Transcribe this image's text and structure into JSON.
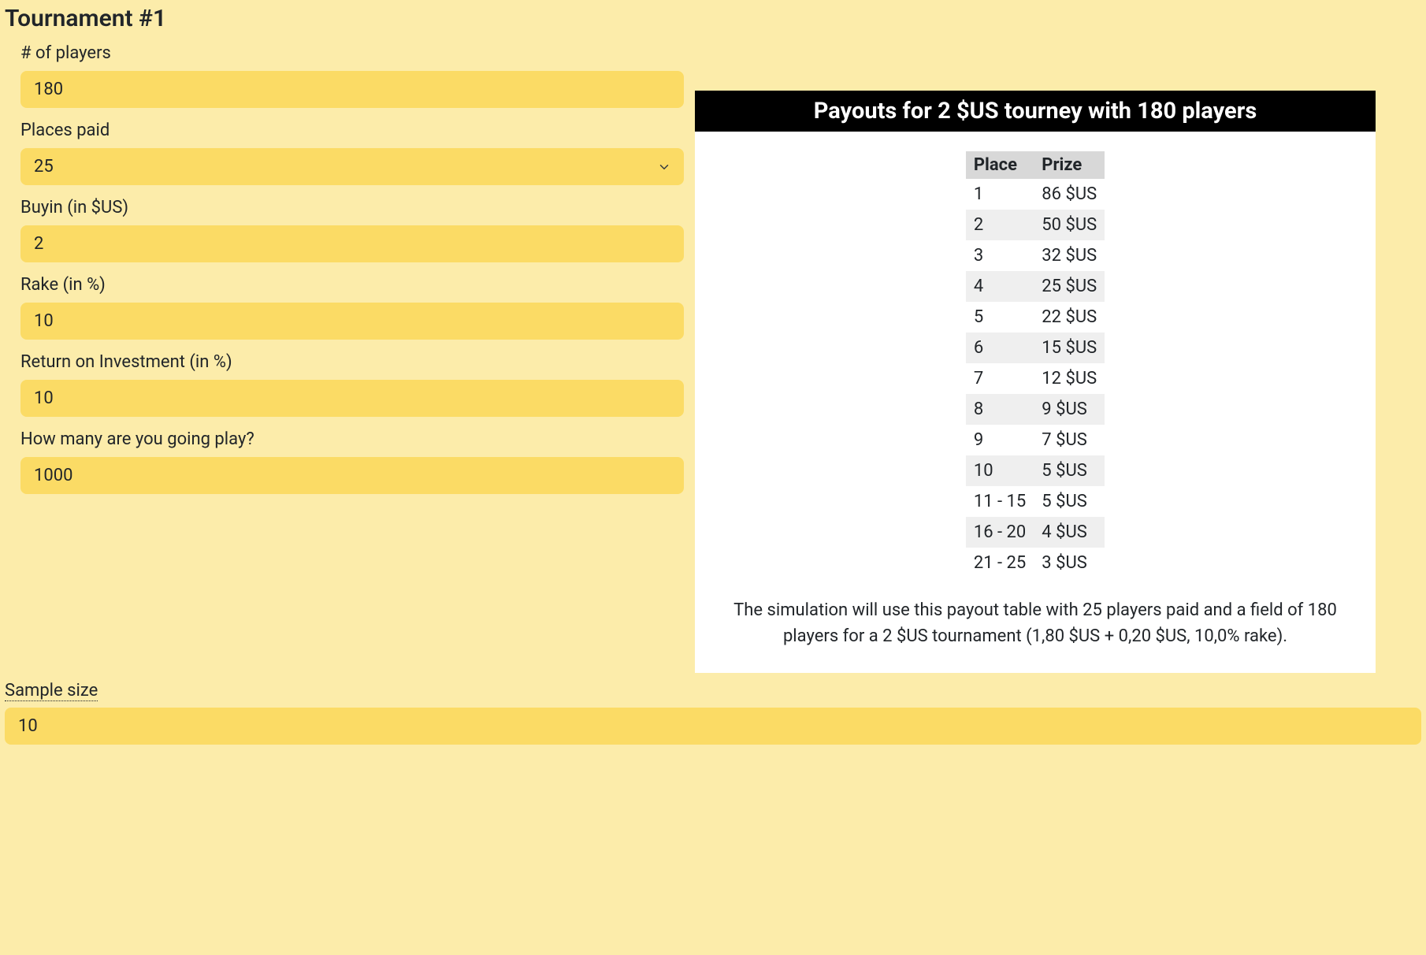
{
  "heading": "Tournament #1",
  "form": {
    "players": {
      "label": "# of players",
      "value": "180"
    },
    "places_paid": {
      "label": "Places paid",
      "value": "25"
    },
    "buyin": {
      "label": "Buyin (in $US)",
      "value": "2"
    },
    "rake": {
      "label": "Rake (in %)",
      "value": "10"
    },
    "roi": {
      "label": "Return on Investment (in %)",
      "value": "10"
    },
    "how_many": {
      "label": "How many are you going play?",
      "value": "1000"
    }
  },
  "payout": {
    "title": "Payouts for 2 $US tourney with 180 players",
    "columns": {
      "place": "Place",
      "prize": "Prize"
    },
    "rows": [
      {
        "place": "1",
        "prize": "86 $US"
      },
      {
        "place": "2",
        "prize": "50 $US"
      },
      {
        "place": "3",
        "prize": "32 $US"
      },
      {
        "place": "4",
        "prize": "25 $US"
      },
      {
        "place": "5",
        "prize": "22 $US"
      },
      {
        "place": "6",
        "prize": "15 $US"
      },
      {
        "place": "7",
        "prize": "12 $US"
      },
      {
        "place": "8",
        "prize": "9 $US"
      },
      {
        "place": "9",
        "prize": "7 $US"
      },
      {
        "place": "10",
        "prize": "5 $US"
      },
      {
        "place": "11 - 15",
        "prize": "5 $US"
      },
      {
        "place": "16 - 20",
        "prize": "4 $US"
      },
      {
        "place": "21 - 25",
        "prize": "3 $US"
      }
    ],
    "sim_text": "The simulation will use this payout table with 25 players paid and a field of 180 players for a 2 $US tournament (1,80 $US + 0,20 $US, 10,0% rake)."
  },
  "sample": {
    "label": "Sample size",
    "value": "10"
  }
}
